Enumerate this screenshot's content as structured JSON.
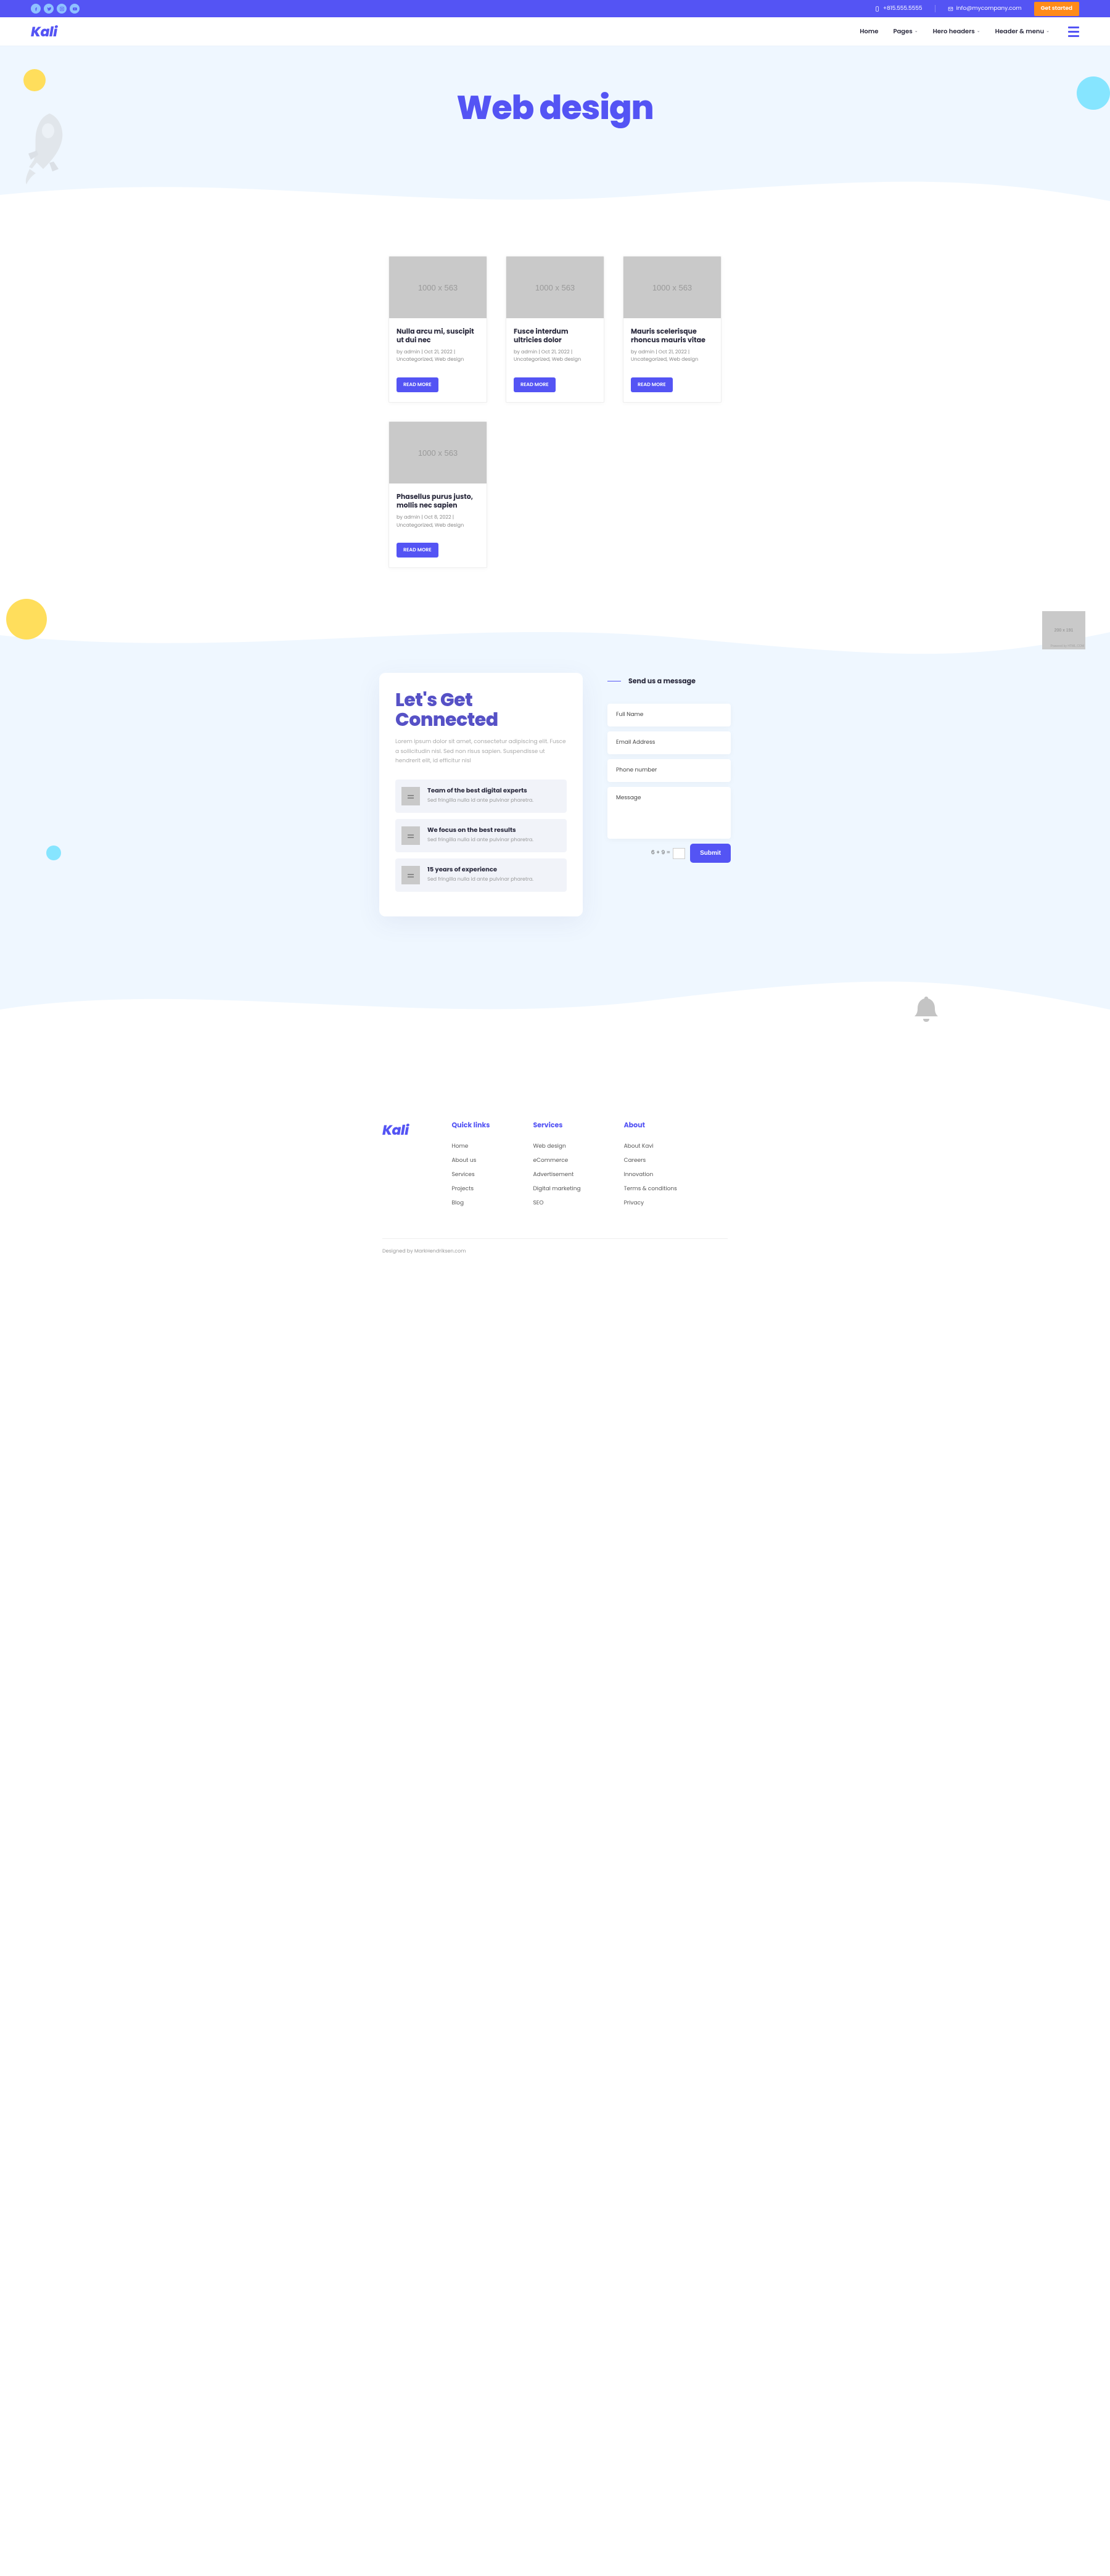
{
  "topbar": {
    "phone": "+815.555.5555",
    "email": "info@mycompany.com",
    "cta": "Get started"
  },
  "nav": {
    "logo": "Kali",
    "links": [
      "Home",
      "Pages",
      "Hero headers",
      "Header & menu"
    ]
  },
  "hero": {
    "title": "Web design"
  },
  "placeholder_img": "1000 x 563",
  "articles": [
    {
      "title": "Nulla arcu mi, suscipit ut dui nec",
      "meta": "by admin | Oct 21, 2022 | Uncategorized, Web design",
      "btn": "READ MORE"
    },
    {
      "title": "Fusce interdum ultricies dolor",
      "meta": "by admin | Oct 21, 2022 | Uncategorized, Web design",
      "btn": "READ MORE"
    },
    {
      "title": "Mauris scelerisque rhoncus mauris vitae",
      "meta": "by admin | Oct 21, 2022 | Uncategorized, Web design",
      "btn": "READ MORE"
    },
    {
      "title": "Phasellus purus justo, mollis nec sapien",
      "meta": "by admin | Oct 8, 2022 | Uncategorized, Web design",
      "btn": "READ MORE"
    }
  ],
  "contact": {
    "placeholder_sm": "200 x 191",
    "heading": "Let's Get Connected",
    "intro": "Lorem ipsum dolor sit amet, consectetur adipiscing elit. Fusce a sollicitudin nisl. Sed non risus sapien. Suspendisse ut hendrerit elit, id efficitur nisl",
    "features": [
      {
        "title": "Team of the best digital experts",
        "desc": "Sed fringilla nulla id ante pulvinar pharetra."
      },
      {
        "title": "We focus on the best results",
        "desc": "Sed fringilla nulla id ante pulvinar pharetra."
      },
      {
        "title": "15 years of experience",
        "desc": "Sed fringilla nulla id ante pulvinar pharetra."
      }
    ],
    "form": {
      "heading": "Send us a message",
      "name": "Full Name",
      "email": "Email Address",
      "phone": "Phone number",
      "msg": "Message",
      "quiz": "6 + 9 =",
      "submit": "Submit"
    }
  },
  "footer": {
    "logo": "Kali",
    "cols": [
      {
        "title": "Quick links",
        "links": [
          "Home",
          "About us",
          "Services",
          "Projects",
          "Blog"
        ]
      },
      {
        "title": "Services",
        "links": [
          "Web design",
          "eCommerce",
          "Advertisement",
          "Digital marketing",
          "SEO"
        ]
      },
      {
        "title": "About",
        "links": [
          "About Kavi",
          "Careers",
          "Innovation",
          "Terms & conditions",
          "Privacy"
        ]
      }
    ],
    "credit": "Designed by MarkHendriksen.com"
  }
}
